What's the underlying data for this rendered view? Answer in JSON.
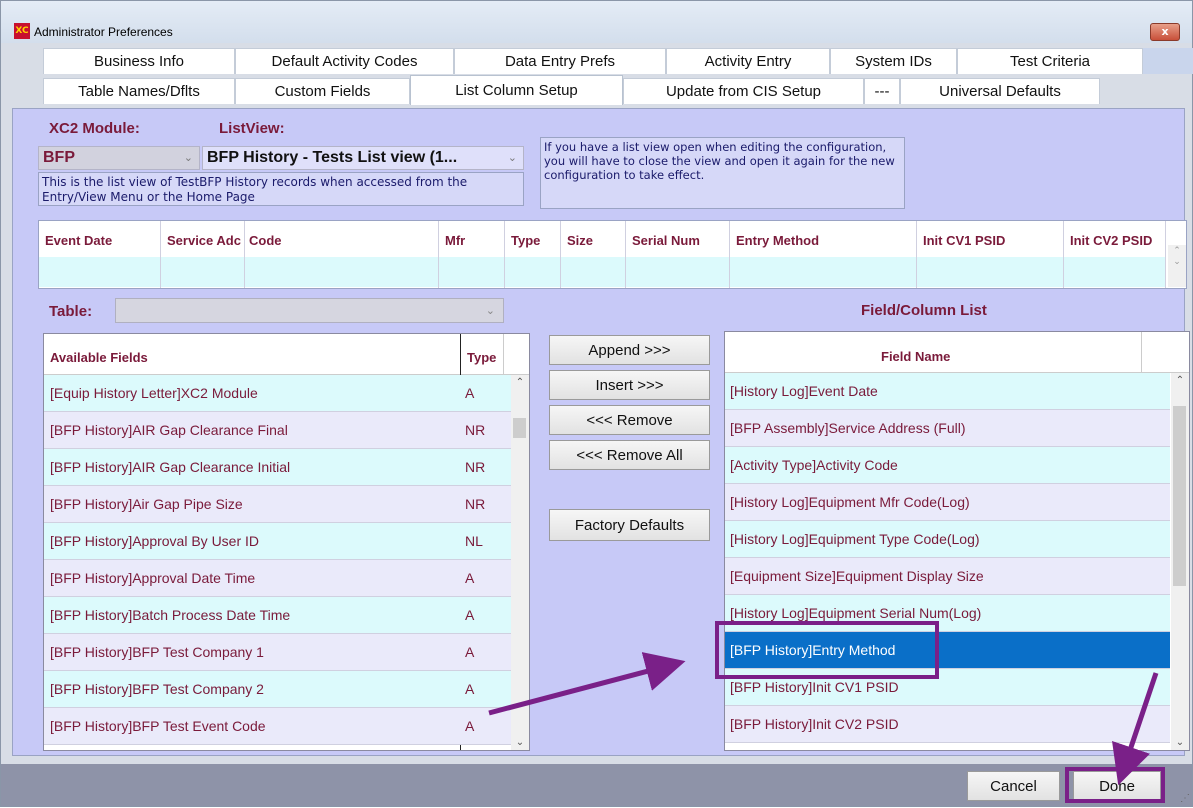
{
  "window": {
    "title": "Administrator Preferences",
    "close_glyph": "x"
  },
  "tabs_row1": [
    {
      "label": "Business Info"
    },
    {
      "label": "Default Activity Codes"
    },
    {
      "label": "Data Entry Prefs"
    },
    {
      "label": "Activity Entry"
    },
    {
      "label": "System IDs"
    },
    {
      "label": "Test Criteria"
    }
  ],
  "tabs_row2": [
    {
      "label": "Table Names/Dflts"
    },
    {
      "label": "Custom Fields"
    },
    {
      "label": "List Column Setup"
    },
    {
      "label": "Update from CIS Setup"
    },
    {
      "label": "---"
    },
    {
      "label": "Universal Defaults"
    }
  ],
  "active_tab": "List Column Setup",
  "module": {
    "label": "XC2 Module:",
    "value": "BFP"
  },
  "listview": {
    "label": "ListView:",
    "value": "BFP History - Tests List view  (1..."
  },
  "description": "This is the list view of TestBFP History records when accessed from the Entry/View Menu or the Home Page",
  "note": "If you have a list view open when editing the configuration, you will have to close the view and open it again for the new configuration to take effect.",
  "preview_columns": [
    "Event Date",
    "Service Adc",
    "Code",
    "Mfr",
    "Type",
    "Size",
    "Serial Num",
    "Entry Method",
    "Init CV1 PSID",
    "Init CV2 PSID"
  ],
  "table": {
    "label": "Table:",
    "value": ""
  },
  "field_column_list_label": "Field/Column List",
  "available_fields": {
    "header_name": "Available Fields",
    "header_type": "Type",
    "rows": [
      {
        "name": "[Equip History Letter]XC2 Module",
        "type": "A"
      },
      {
        "name": "[BFP History]AIR Gap Clearance Final",
        "type": "NR"
      },
      {
        "name": "[BFP History]AIR Gap Clearance Initial",
        "type": "NR"
      },
      {
        "name": "[BFP History]Air Gap Pipe Size",
        "type": "NR"
      },
      {
        "name": "[BFP History]Approval By User ID",
        "type": "NL"
      },
      {
        "name": "[BFP History]Approval Date Time",
        "type": "A"
      },
      {
        "name": "[BFP History]Batch Process Date Time",
        "type": "A"
      },
      {
        "name": "[BFP History]BFP Test Company 1",
        "type": "A"
      },
      {
        "name": "[BFP History]BFP Test Company 2",
        "type": "A"
      },
      {
        "name": "[BFP History]BFP Test Event Code",
        "type": "A"
      }
    ]
  },
  "buttons": {
    "append": "Append >>>",
    "insert": "Insert >>>",
    "remove": "<<< Remove",
    "remove_all": "<<< Remove All",
    "factory_defaults": "Factory Defaults",
    "cancel": "Cancel",
    "done": "Done"
  },
  "field_list": {
    "header": "Field Name",
    "selected_index": 7,
    "rows": [
      "[History Log]Event Date",
      "[BFP Assembly]Service Address (Full)",
      "[Activity Type]Activity Code",
      "[History Log]Equipment Mfr Code(Log)",
      "[History Log]Equipment Type Code(Log)",
      "[Equipment Size]Equipment Display Size",
      "[History Log]Equipment Serial Num(Log)",
      "[BFP History]Entry Method",
      "[BFP History]Init CV1 PSID",
      "[BFP History]Init CV2 PSID"
    ]
  },
  "colors": {
    "panel": "#c7c9f7",
    "label": "#7a1a3a",
    "row_cyan": "#dcfafc",
    "row_lavender": "#eaeafa",
    "selection": "#0a6fc8",
    "annotation": "#7a2088",
    "footer": "#8e93a8"
  }
}
